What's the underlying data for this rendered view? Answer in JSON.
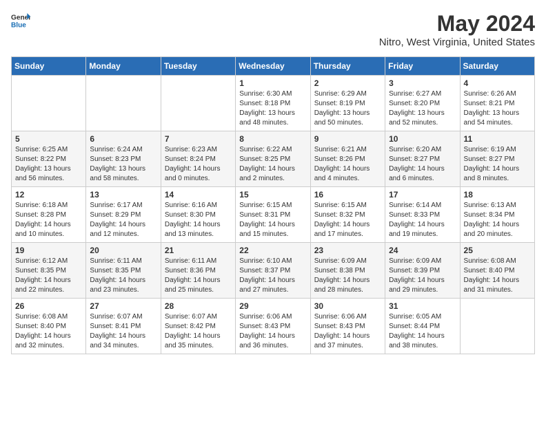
{
  "header": {
    "logo_general": "General",
    "logo_blue": "Blue",
    "month_year": "May 2024",
    "location": "Nitro, West Virginia, United States"
  },
  "weekdays": [
    "Sunday",
    "Monday",
    "Tuesday",
    "Wednesday",
    "Thursday",
    "Friday",
    "Saturday"
  ],
  "weeks": [
    [
      {
        "day": "",
        "sunrise": "",
        "sunset": "",
        "daylight": ""
      },
      {
        "day": "",
        "sunrise": "",
        "sunset": "",
        "daylight": ""
      },
      {
        "day": "",
        "sunrise": "",
        "sunset": "",
        "daylight": ""
      },
      {
        "day": "1",
        "sunrise": "Sunrise: 6:30 AM",
        "sunset": "Sunset: 8:18 PM",
        "daylight": "Daylight: 13 hours and 48 minutes."
      },
      {
        "day": "2",
        "sunrise": "Sunrise: 6:29 AM",
        "sunset": "Sunset: 8:19 PM",
        "daylight": "Daylight: 13 hours and 50 minutes."
      },
      {
        "day": "3",
        "sunrise": "Sunrise: 6:27 AM",
        "sunset": "Sunset: 8:20 PM",
        "daylight": "Daylight: 13 hours and 52 minutes."
      },
      {
        "day": "4",
        "sunrise": "Sunrise: 6:26 AM",
        "sunset": "Sunset: 8:21 PM",
        "daylight": "Daylight: 13 hours and 54 minutes."
      }
    ],
    [
      {
        "day": "5",
        "sunrise": "Sunrise: 6:25 AM",
        "sunset": "Sunset: 8:22 PM",
        "daylight": "Daylight: 13 hours and 56 minutes."
      },
      {
        "day": "6",
        "sunrise": "Sunrise: 6:24 AM",
        "sunset": "Sunset: 8:23 PM",
        "daylight": "Daylight: 13 hours and 58 minutes."
      },
      {
        "day": "7",
        "sunrise": "Sunrise: 6:23 AM",
        "sunset": "Sunset: 8:24 PM",
        "daylight": "Daylight: 14 hours and 0 minutes."
      },
      {
        "day": "8",
        "sunrise": "Sunrise: 6:22 AM",
        "sunset": "Sunset: 8:25 PM",
        "daylight": "Daylight: 14 hours and 2 minutes."
      },
      {
        "day": "9",
        "sunrise": "Sunrise: 6:21 AM",
        "sunset": "Sunset: 8:26 PM",
        "daylight": "Daylight: 14 hours and 4 minutes."
      },
      {
        "day": "10",
        "sunrise": "Sunrise: 6:20 AM",
        "sunset": "Sunset: 8:27 PM",
        "daylight": "Daylight: 14 hours and 6 minutes."
      },
      {
        "day": "11",
        "sunrise": "Sunrise: 6:19 AM",
        "sunset": "Sunset: 8:27 PM",
        "daylight": "Daylight: 14 hours and 8 minutes."
      }
    ],
    [
      {
        "day": "12",
        "sunrise": "Sunrise: 6:18 AM",
        "sunset": "Sunset: 8:28 PM",
        "daylight": "Daylight: 14 hours and 10 minutes."
      },
      {
        "day": "13",
        "sunrise": "Sunrise: 6:17 AM",
        "sunset": "Sunset: 8:29 PM",
        "daylight": "Daylight: 14 hours and 12 minutes."
      },
      {
        "day": "14",
        "sunrise": "Sunrise: 6:16 AM",
        "sunset": "Sunset: 8:30 PM",
        "daylight": "Daylight: 14 hours and 13 minutes."
      },
      {
        "day": "15",
        "sunrise": "Sunrise: 6:15 AM",
        "sunset": "Sunset: 8:31 PM",
        "daylight": "Daylight: 14 hours and 15 minutes."
      },
      {
        "day": "16",
        "sunrise": "Sunrise: 6:15 AM",
        "sunset": "Sunset: 8:32 PM",
        "daylight": "Daylight: 14 hours and 17 minutes."
      },
      {
        "day": "17",
        "sunrise": "Sunrise: 6:14 AM",
        "sunset": "Sunset: 8:33 PM",
        "daylight": "Daylight: 14 hours and 19 minutes."
      },
      {
        "day": "18",
        "sunrise": "Sunrise: 6:13 AM",
        "sunset": "Sunset: 8:34 PM",
        "daylight": "Daylight: 14 hours and 20 minutes."
      }
    ],
    [
      {
        "day": "19",
        "sunrise": "Sunrise: 6:12 AM",
        "sunset": "Sunset: 8:35 PM",
        "daylight": "Daylight: 14 hours and 22 minutes."
      },
      {
        "day": "20",
        "sunrise": "Sunrise: 6:11 AM",
        "sunset": "Sunset: 8:35 PM",
        "daylight": "Daylight: 14 hours and 23 minutes."
      },
      {
        "day": "21",
        "sunrise": "Sunrise: 6:11 AM",
        "sunset": "Sunset: 8:36 PM",
        "daylight": "Daylight: 14 hours and 25 minutes."
      },
      {
        "day": "22",
        "sunrise": "Sunrise: 6:10 AM",
        "sunset": "Sunset: 8:37 PM",
        "daylight": "Daylight: 14 hours and 27 minutes."
      },
      {
        "day": "23",
        "sunrise": "Sunrise: 6:09 AM",
        "sunset": "Sunset: 8:38 PM",
        "daylight": "Daylight: 14 hours and 28 minutes."
      },
      {
        "day": "24",
        "sunrise": "Sunrise: 6:09 AM",
        "sunset": "Sunset: 8:39 PM",
        "daylight": "Daylight: 14 hours and 29 minutes."
      },
      {
        "day": "25",
        "sunrise": "Sunrise: 6:08 AM",
        "sunset": "Sunset: 8:40 PM",
        "daylight": "Daylight: 14 hours and 31 minutes."
      }
    ],
    [
      {
        "day": "26",
        "sunrise": "Sunrise: 6:08 AM",
        "sunset": "Sunset: 8:40 PM",
        "daylight": "Daylight: 14 hours and 32 minutes."
      },
      {
        "day": "27",
        "sunrise": "Sunrise: 6:07 AM",
        "sunset": "Sunset: 8:41 PM",
        "daylight": "Daylight: 14 hours and 34 minutes."
      },
      {
        "day": "28",
        "sunrise": "Sunrise: 6:07 AM",
        "sunset": "Sunset: 8:42 PM",
        "daylight": "Daylight: 14 hours and 35 minutes."
      },
      {
        "day": "29",
        "sunrise": "Sunrise: 6:06 AM",
        "sunset": "Sunset: 8:43 PM",
        "daylight": "Daylight: 14 hours and 36 minutes."
      },
      {
        "day": "30",
        "sunrise": "Sunrise: 6:06 AM",
        "sunset": "Sunset: 8:43 PM",
        "daylight": "Daylight: 14 hours and 37 minutes."
      },
      {
        "day": "31",
        "sunrise": "Sunrise: 6:05 AM",
        "sunset": "Sunset: 8:44 PM",
        "daylight": "Daylight: 14 hours and 38 minutes."
      },
      {
        "day": "",
        "sunrise": "",
        "sunset": "",
        "daylight": ""
      }
    ]
  ]
}
